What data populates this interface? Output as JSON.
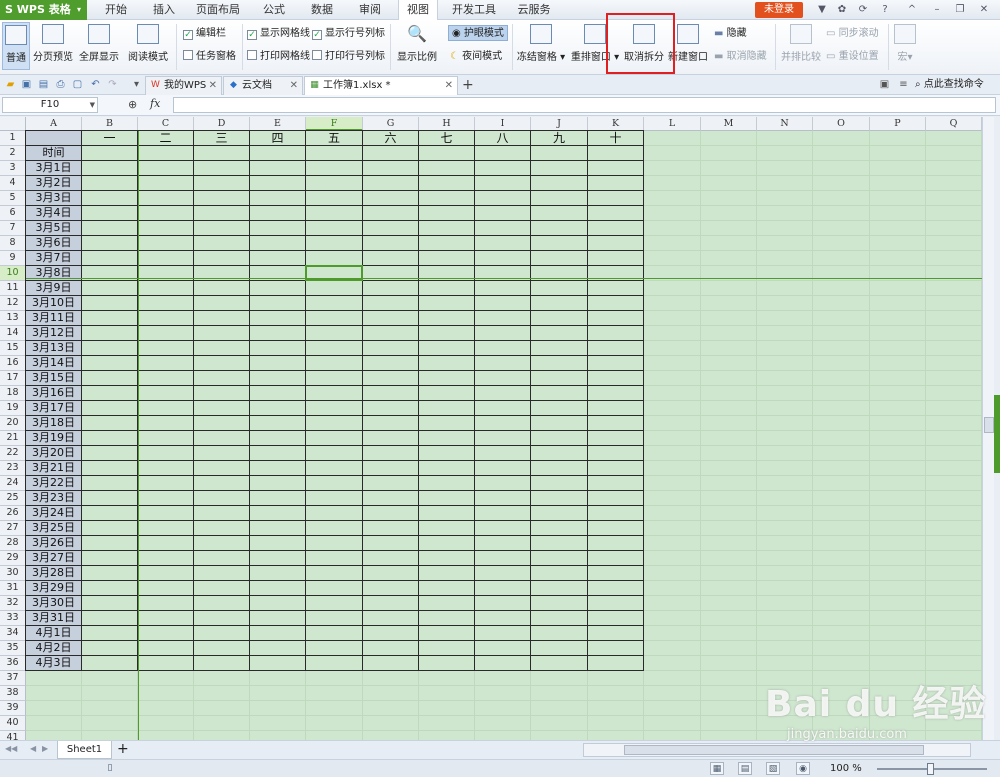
{
  "app": {
    "title": "WPS 表格",
    "logo": "S"
  },
  "menu": [
    "开始",
    "插入",
    "页面布局",
    "公式",
    "数据",
    "审阅",
    "视图",
    "开发工具",
    "云服务"
  ],
  "menu_active": "视图",
  "login": "未登录",
  "ribbon": {
    "normal": "普通",
    "page_break_preview": "分页预览",
    "full_screen": "全屏显示",
    "reading_mode": "阅读模式",
    "edit_bar": "编辑栏",
    "task_pane": "任务窗格",
    "show_gridlines": "显示网格线",
    "print_gridlines": "打印网格线",
    "show_headings": "显示行号列标",
    "print_headings": "打印行号列标",
    "zoom": "显示比例",
    "eye_mode": "护眼模式",
    "night_mode": "夜间模式",
    "freeze_panes": "冻结窗格",
    "arrange_windows": "重排窗口",
    "remove_split": "取消拆分",
    "new_window": "新建窗口",
    "hide": "隐藏",
    "unhide": "取消隐藏",
    "side_by_side": "并排比较",
    "sync_scroll": "同步滚动",
    "reset_position": "重设位置",
    "macro": "宏"
  },
  "tabs": [
    {
      "label": "我的WPS",
      "icon": "wps-icon"
    },
    {
      "label": "云文档",
      "icon": "cloud-icon"
    },
    {
      "label": "工作簿1.xlsx *",
      "icon": "sheet-file-icon"
    }
  ],
  "find_command": "点此查找命令",
  "formula": {
    "name_box": "F10",
    "fx": "fx",
    "value": ""
  },
  "grid": {
    "columns": [
      "A",
      "B",
      "C",
      "D",
      "E",
      "F",
      "G",
      "H",
      "I",
      "J",
      "K",
      "L",
      "M",
      "N",
      "O",
      "P",
      "Q"
    ],
    "rows": [
      "1",
      "2",
      "3",
      "4",
      "5",
      "6",
      "7",
      "8",
      "9",
      "10",
      "11",
      "12",
      "13",
      "14",
      "15",
      "16",
      "17",
      "18",
      "19",
      "20",
      "21",
      "22",
      "23",
      "24",
      "25",
      "26",
      "27",
      "28",
      "29",
      "30",
      "31",
      "32",
      "33",
      "34",
      "35",
      "36",
      "37",
      "38",
      "39",
      "40",
      "41"
    ],
    "selected_cell": "F10",
    "header_row": [
      "一",
      "二",
      "三",
      "四",
      "五",
      "六",
      "七",
      "八",
      "九",
      "十"
    ],
    "time_label": "时间",
    "dates": [
      "3月1日",
      "3月2日",
      "3月3日",
      "3月4日",
      "3月5日",
      "3月6日",
      "3月7日",
      "3月8日",
      "3月9日",
      "3月10日",
      "3月11日",
      "3月12日",
      "3月13日",
      "3月14日",
      "3月15日",
      "3月16日",
      "3月17日",
      "3月18日",
      "3月19日",
      "3月20日",
      "3月21日",
      "3月22日",
      "3月23日",
      "3月24日",
      "3月25日",
      "3月26日",
      "3月27日",
      "3月28日",
      "3月29日",
      "3月30日",
      "3月31日",
      "4月1日",
      "4月2日",
      "4月3日"
    ]
  },
  "sheets": [
    "Sheet1"
  ],
  "status": {
    "zoom": "100 %"
  },
  "watermark": {
    "brand": "Bai du 经验",
    "url": "jingyan.baidu.com"
  },
  "colors": {
    "brand_green": "#4f9d2d",
    "login_orange": "#e2501d",
    "eye_mode_bg": "#cfe6cf",
    "highlight_red": "#e02020"
  }
}
